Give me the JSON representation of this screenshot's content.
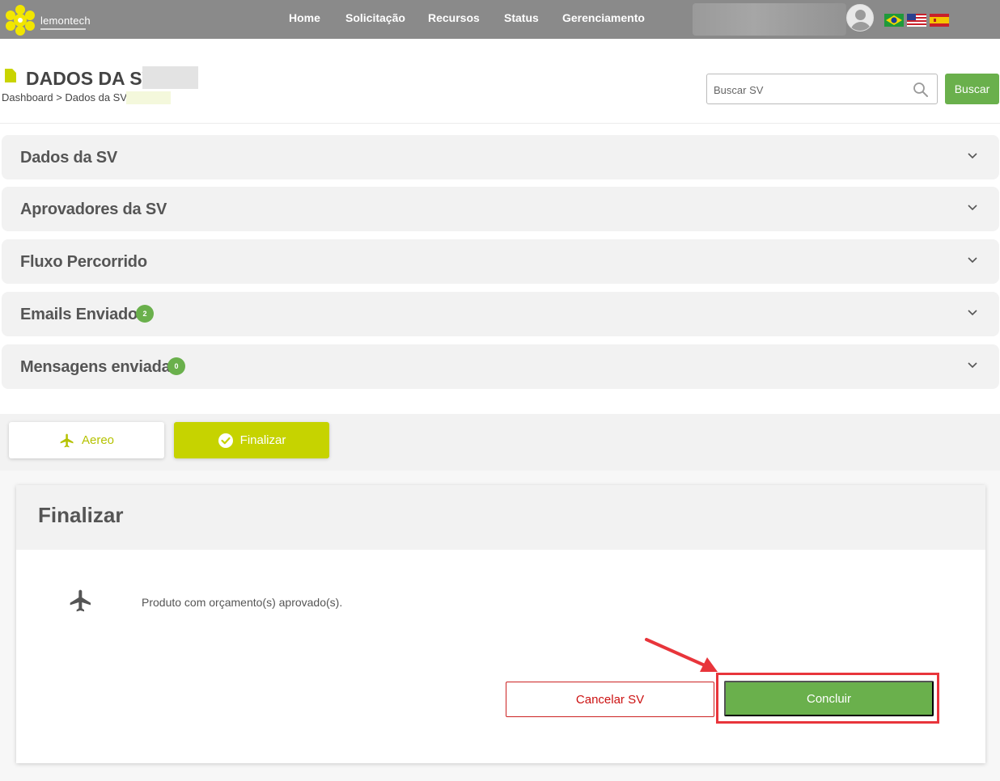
{
  "brand": {
    "name": "lemontech"
  },
  "nav": {
    "items": [
      {
        "label": "Home"
      },
      {
        "label": "Solicitação"
      },
      {
        "label": "Recursos"
      },
      {
        "label": "Status"
      },
      {
        "label": "Gerenciamento"
      }
    ]
  },
  "languages": [
    "brazil-flag-icon",
    "usa-flag-icon",
    "spain-flag-icon"
  ],
  "header": {
    "title": "DADOS DA SV",
    "breadcrumb": "Dashboard > Dados da SV >"
  },
  "search": {
    "placeholder": "Buscar SV",
    "value": "",
    "button_label": "Buscar"
  },
  "accordion": [
    {
      "title": "Dados da SV"
    },
    {
      "title": "Aprovadores da SV"
    },
    {
      "title": "Fluxo Percorrido"
    },
    {
      "title": "Emails Enviados",
      "badge": "2"
    },
    {
      "title": "Mensagens enviadas",
      "badge": "0"
    }
  ],
  "tabs": [
    {
      "label": "Aereo",
      "icon": "plane-icon"
    },
    {
      "label": "Finalizar",
      "icon": "check-circle-icon"
    }
  ],
  "finalize": {
    "title": "Finalizar",
    "product_text": "Produto com orçamento(s) aprovado(s).",
    "cancel_label": "Cancelar SV",
    "confirm_label": "Concluir"
  },
  "colors": {
    "topbar": "#8a8a8a",
    "brand_yellow": "#c6d300",
    "green": "#6ab04c",
    "cancel_red": "#cc1111",
    "highlight_red": "#e8353b"
  }
}
